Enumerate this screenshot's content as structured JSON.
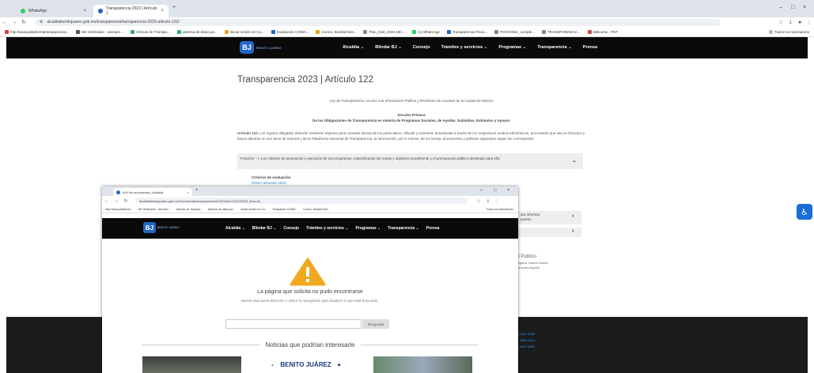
{
  "browser": {
    "tabs": [
      {
        "label": "WhatsApp"
      },
      {
        "label": "Transparencia 2023 | Artículo 1"
      }
    ],
    "url": "alcaldiabenitojuarez.gob.mx/transparencia/transparencia-2023-articulo-122/",
    "bookmarks": [
      "http://www.plataformatransparencia...",
      "Me Verificador - anexam...",
      "Artículo de Transpa...",
      "sistema de datos pa...",
      "Iniciar sesión en Cu...",
      "Evaluación COMA...",
      "Correo: Brasbel Mor...",
      "Plan_Gral_2019 18C...",
      "(1) WhatsApp",
      "Transparencia Fisca...",
      "POSCOMA_comple...",
      "TRANSPARENCIA...",
      "Welcome - PNT"
    ],
    "all_bookmarks": "Todos los marcadores"
  },
  "site": {
    "logo_text": "BJ",
    "logo_caption": "BENITO JUÁREZ",
    "menu": [
      "Alcaldía",
      "Blindar BJ",
      "Consejo",
      "Trámites y servicios",
      "Programas",
      "Transparencia",
      "Prensa"
    ]
  },
  "page": {
    "title": "Transparencia 2023 | Artículo 122",
    "law": "Ley de Transparencia, Acceso a la Información Pública y Rendición de Cuentas de la Ciudad de México",
    "section_title": "Sección Primera",
    "section_sub": "De las Obligaciones de Transparencia en materia de Programas Sociales, de Ayudas, Subsidios, Estímulos y Apoyos",
    "article_lead": "Artículo 122.",
    "article_text": "Los sujetos obligados deberán mantener impresa para consulta directa de los particulares, difundir y mantener actualizada a través de los respectivos medios electrónicos, procurando que sea en formatos y bases abiertas en sus sitios de Internet y de la Plataforma Nacional de Transparencia, la información, por lo menos, de los temas, documentos y políticas siguientes según les corresponda:",
    "fraccion": "Fracción – I. Los criterios de planeación y ejecución de sus programas, especificando las metas y objetivos anualmente y el presupuesto público destinado para ello;",
    "criteria_label": "Criterios de evaluación",
    "criteria_link": "Primer trimestre 2023",
    "row2_text": "ara informar",
    "row2_text2": "puesto",
    "side_title": "al Público",
    "side_name1": "Ángeles García Huerta",
    "side_name2": "Gonzalez Aguilar",
    "footer_lines": [
      "(55) 5422 5300",
      "Ext. 3800 1214",
      "(55) 5422 5300"
    ]
  },
  "popup": {
    "tab_label": "404 No encontrado | Alcaldía",
    "url": "alcaldiabenitojuarez.gob.mx/Documentos/transparencia/2023/art122/A122f04_3ertr.xls",
    "bookmarks": [
      "http://www.plataform...",
      "Me Verificador - anexam...",
      "Artículo de Transpa...",
      "sistema de datos pa...",
      "Iniciar sesión en Cu...",
      "Evaluación COMA...",
      "Correo: Brasbel Mor..."
    ],
    "all_bookmarks": "Todos los marcadores",
    "error_title": "La página que solicita no pudo encontrarse",
    "error_desc": "Intente una nueva dirección o utilice la navegación para localizar lo que está buscando.",
    "search_button": "Búsqueda",
    "news_heading": "Noticias que podrían interesarle",
    "news_brand": "BENITO JUÁREZ"
  },
  "colors": {
    "accent": "#2266c8",
    "nav_bg": "#0a0a0a",
    "warning": "#f0a81e"
  }
}
